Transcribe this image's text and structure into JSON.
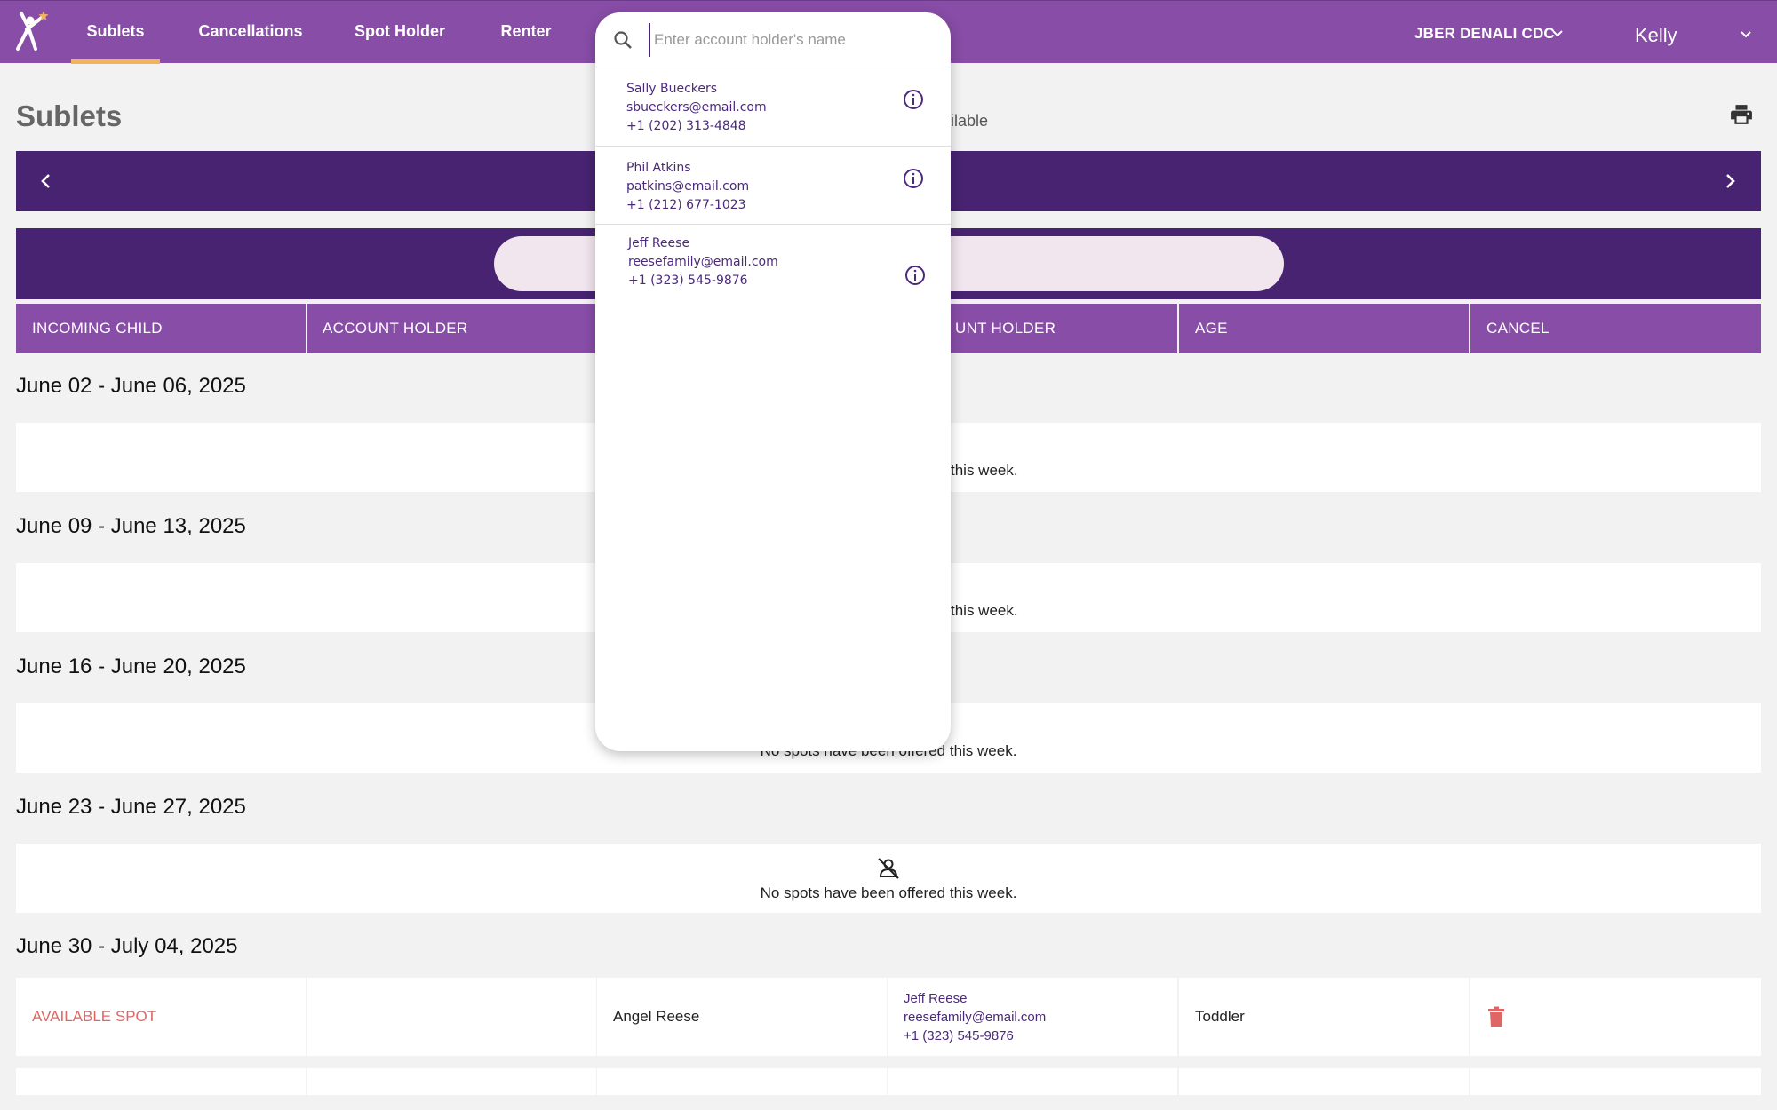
{
  "nav": {
    "tabs": [
      {
        "label": "Sublets",
        "active": true
      },
      {
        "label": "Cancellations",
        "active": false
      },
      {
        "label": "Spot Holder",
        "active": false
      },
      {
        "label": "Renter",
        "active": false
      }
    ],
    "org": "JBER DENALI CDC",
    "user": "Kelly"
  },
  "page": {
    "title": "Sublets",
    "available_fragment": "ailable"
  },
  "columns": [
    "INCOMING CHILD",
    "ACCOUNT HOLDER",
    "",
    "UNT HOLDER",
    "AGE",
    "CANCEL"
  ],
  "weeks": [
    {
      "label": "June 02 - June 06, 2025",
      "empty_text": "this week."
    },
    {
      "label": "June 09 - June 13, 2025",
      "empty_text": "this week."
    },
    {
      "label": "June 16 - June 20, 2025",
      "empty_text": "No spots have been offered this week."
    },
    {
      "label": "June 23 - June 27, 2025",
      "empty_text": "No spots have been offered this week."
    },
    {
      "label": "June 30 - July 04, 2025",
      "empty_text": ""
    }
  ],
  "row": {
    "incoming_child": "AVAILABLE SPOT",
    "account_holder": "",
    "child_name": "Angel Reese",
    "holder": {
      "name": "Jeff Reese",
      "email": "reesefamily@email.com",
      "phone": "+1 (323) 545-9876"
    },
    "age": "Toddler"
  },
  "dropdown": {
    "placeholder": "Enter account holder's name",
    "value": "",
    "options": [
      {
        "name": "Sally Bueckers",
        "email": "sbueckers@email.com",
        "phone": "+1 (202) 313-4848"
      },
      {
        "name": "Phil Atkins",
        "email": "patkins@email.com",
        "phone": "+1 (212) 677-1023"
      },
      {
        "name": "Jeff Reese",
        "email": "reesefamily@email.com",
        "phone": "+1 (323) 545-9876"
      }
    ]
  },
  "colors": {
    "header_purple": "#884da7",
    "dark_purple": "#472371",
    "accent_orange": "#f2b35b",
    "available_red": "#e06666",
    "link_purple": "#4b2a7b"
  },
  "icons": [
    "logo-icon",
    "chevron-down-icon",
    "print-icon",
    "chevron-left-icon",
    "chevron-right-icon",
    "no-person-icon",
    "trash-icon",
    "search-icon",
    "info-icon"
  ]
}
